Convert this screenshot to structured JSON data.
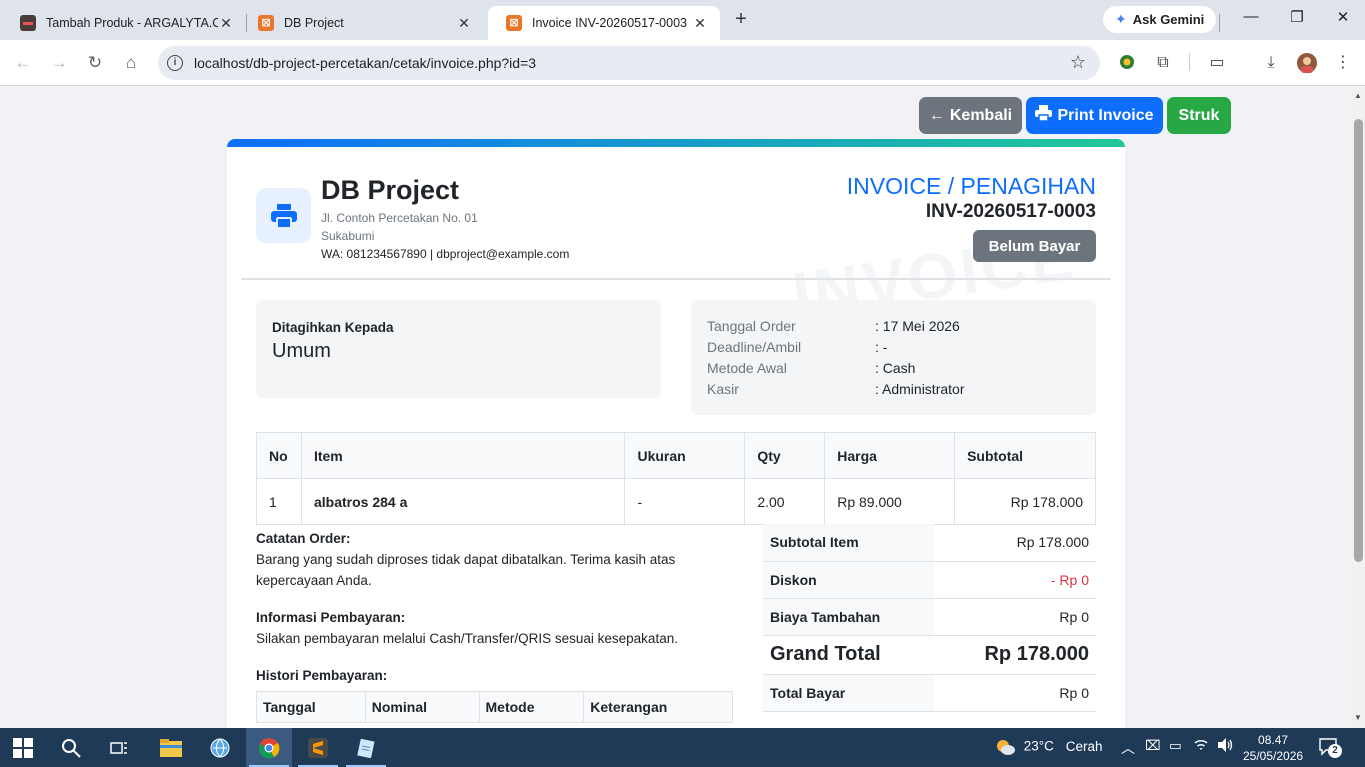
{
  "browser": {
    "tabs": [
      {
        "title": "Tambah Produk - ARGALYTA.CO",
        "active": false
      },
      {
        "title": "DB Project",
        "active": false
      },
      {
        "title": "Invoice INV-20260517-0003",
        "active": true
      }
    ],
    "new_tab": "+",
    "ask_gemini": "Ask Gemini",
    "url": "localhost/db-project-percetakan/cetak/invoice.php?id=3"
  },
  "actions": {
    "back": "Kembali",
    "print": "Print Invoice",
    "struk": "Struk"
  },
  "company": {
    "name": "DB Project",
    "address": "Jl. Contoh Percetakan No. 01",
    "city": "Sukabumi",
    "contact": "WA: 081234567890 | dbproject@example.com"
  },
  "invoice": {
    "title": "INVOICE / PENAGIHAN",
    "number": "INV-20260517-0003",
    "status": "Belum Bayar",
    "watermark": "INVOICE"
  },
  "billing": {
    "label": "Ditagihkan Kepada",
    "name": "Umum"
  },
  "meta": [
    {
      "key": "Tanggal Order",
      "value": ": 17 Mei 2026"
    },
    {
      "key": "Deadline/Ambil",
      "value": ": -"
    },
    {
      "key": "Metode Awal",
      "value": ": Cash"
    },
    {
      "key": "Kasir",
      "value": ": Administrator"
    }
  ],
  "items_table": {
    "headers": [
      "No",
      "Item",
      "Ukuran",
      "Qty",
      "Harga",
      "Subtotal"
    ],
    "rows": [
      {
        "no": "1",
        "item": "albatros 284 a",
        "ukuran": "-",
        "qty": "2.00",
        "harga": "Rp 89.000",
        "subtotal": "Rp 178.000"
      }
    ]
  },
  "notes": {
    "order_title": "Catatan Order:",
    "order_text": "Barang yang sudah diproses tidak dapat dibatalkan. Terima kasih atas kepercayaan Anda.",
    "payment_title": "Informasi Pembayaran:",
    "payment_text": "Silakan pembayaran melalui Cash/Transfer/QRIS sesuai kesepakatan.",
    "history_title": "Histori Pembayaran:"
  },
  "history_table": {
    "headers": [
      "Tanggal",
      "Nominal",
      "Metode",
      "Keterangan"
    ]
  },
  "summary": [
    {
      "key": "Subtotal Item",
      "value": "Rp 178.000"
    },
    {
      "key": "Diskon",
      "value": "- Rp 0"
    },
    {
      "key": "Biaya Tambahan",
      "value": "Rp 0"
    },
    {
      "key": "Grand Total",
      "value": "Rp 178.000"
    },
    {
      "key": "Total Bayar",
      "value": "Rp 0"
    }
  ],
  "colors": {
    "primary": "#0d6efd",
    "secondary": "#6c757d",
    "success": "#28a745",
    "danger": "#dc3545",
    "accent_gradient_end": "#20c997"
  },
  "taskbar": {
    "weather_temp": "23°C",
    "weather_text": "Cerah",
    "time": "08.47",
    "date": "25/05/2026",
    "notifications": "2"
  }
}
